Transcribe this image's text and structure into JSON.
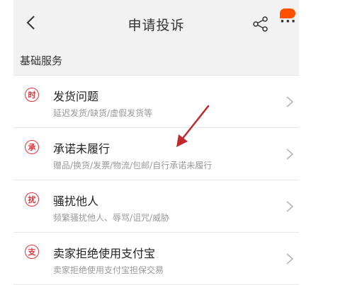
{
  "header": {
    "title": "申请投诉",
    "back_icon": "chevron-left-icon",
    "share_icon": "share-icon",
    "more_icon": "more-icon"
  },
  "section": {
    "title": "基础服务"
  },
  "items": [
    {
      "icon_char": "时",
      "title": "发货问题",
      "subtitle": "延迟发货/缺货/虚假发货等"
    },
    {
      "icon_char": "承",
      "title": "承诺未履行",
      "subtitle": "赠品/换货/发票/物流/包邮/自行承诺未履行"
    },
    {
      "icon_char": "扰",
      "title": "骚扰他人",
      "subtitle": "频繁骚扰他人、辱骂/诅咒/威胁"
    },
    {
      "icon_char": "支",
      "title": "卖家拒绝使用支付宝",
      "subtitle": "卖家拒绝使用支付宝担保交易"
    }
  ],
  "colors": {
    "accent_red": "#e0343a",
    "badge_orange": "#ff5000",
    "annotation_arrow": "#c0292b"
  }
}
